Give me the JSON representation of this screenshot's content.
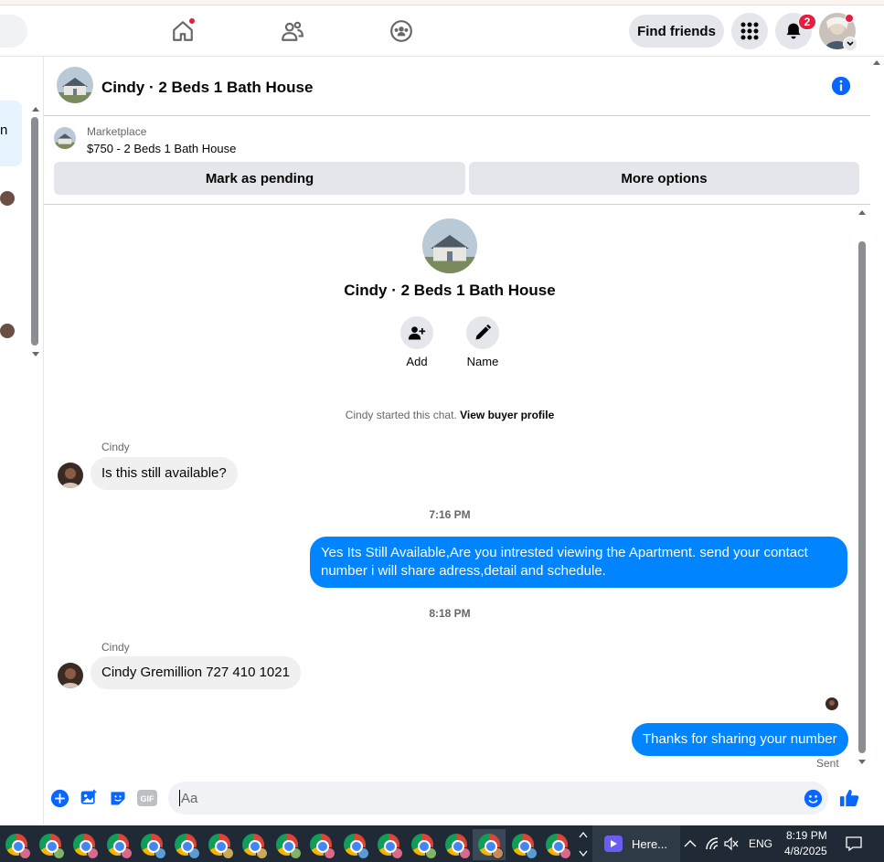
{
  "topbar": {
    "find_friends_label": "Find friends",
    "notifications_count": "2"
  },
  "chat": {
    "header_title": "Cindy · 2 Beds 1 Bath House",
    "marketplace_label": "Marketplace",
    "listing_title": "$750 - 2 Beds 1 Bath House",
    "mark_pending_label": "Mark as pending",
    "more_options_label": "More options",
    "center_title": "Cindy · 2 Beds 1 Bath House",
    "add_label": "Add",
    "name_label": "Name",
    "system_prefix": "Cindy started this chat.",
    "system_link": "View buyer profile",
    "messages": [
      {
        "sender": "Cindy",
        "text": "Is this still available?"
      },
      {
        "timestamp": "7:16 PM"
      },
      {
        "text": "Yes Its Still Available,Are you intrested viewing the Apartment. send your contact number i will share adress,detail and schedule."
      },
      {
        "timestamp": "8:18 PM"
      },
      {
        "sender": "Cindy",
        "text": "Cindy Gremillion 727 410 1021"
      },
      {
        "text": "Thanks for sharing your number"
      }
    ],
    "sent_label": "Sent",
    "composer_placeholder": "Aa"
  },
  "left": {
    "partial_text": "n"
  },
  "taskbar": {
    "search_text": "Here...",
    "language": "ENG",
    "time": "8:19 PM",
    "date": "4/8/2025"
  },
  "colors": {
    "accent": "#0084ff",
    "brand": "#0866ff",
    "badge": "#e41e3f"
  }
}
